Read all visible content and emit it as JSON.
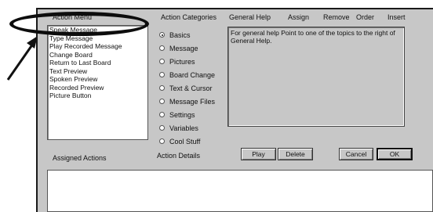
{
  "action_menu": {
    "label": "Action Menu",
    "items": [
      "Speak Message",
      "Type Message",
      "Play Recorded Message",
      "Change Board",
      "Return to Last Board",
      "Text Preview",
      "Spoken Preview",
      "Recorded Preview",
      "Picture Button"
    ],
    "selected_index": 0
  },
  "categories": {
    "label": "Action Categories",
    "options": [
      "Basics",
      "Message",
      "Pictures",
      "Board Change",
      "Text & Cursor",
      "Message Files",
      "Settings",
      "Variables",
      "Cool Stuff"
    ],
    "selected_index": 0
  },
  "header_tabs": {
    "general_help": "General Help",
    "assign": "Assign",
    "remove": "Remove",
    "order": "Order",
    "insert": "Insert"
  },
  "help_text": "For general help Point to one of the topics to the right of General Help.",
  "buttons": {
    "play": "Play",
    "delete": "Delete",
    "cancel": "Cancel",
    "ok": "OK"
  },
  "assigned_actions": {
    "label": "Assigned Actions"
  },
  "action_details": {
    "label": "Action Details"
  }
}
